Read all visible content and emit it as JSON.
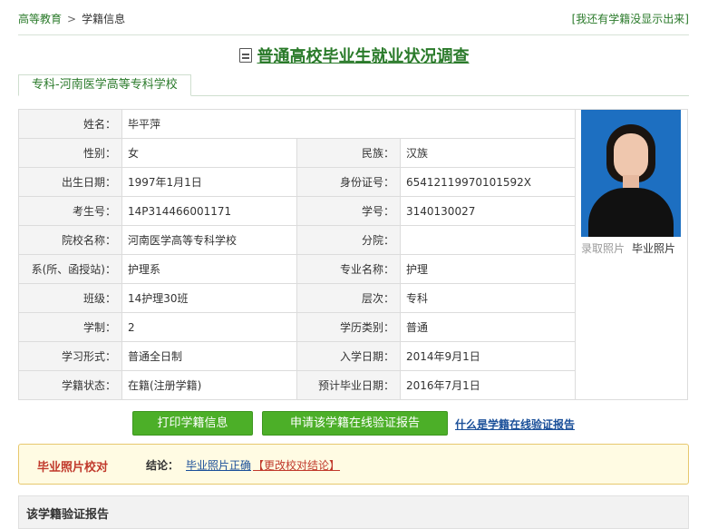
{
  "breadcrumb": {
    "home": "高等教育",
    "sep": ">",
    "current": "学籍信息"
  },
  "not_shown_link": "[我还有学籍没显示出来]",
  "page_title": "普通高校毕业生就业状况调查",
  "tab_label": "专科-河南医学高等专科学校",
  "info": {
    "name_label": "姓名：",
    "name": "毕平萍",
    "gender_label": "性别：",
    "gender": "女",
    "ethnicity_label": "民族：",
    "ethnicity": "汉族",
    "birth_label": "出生日期：",
    "birth": "1997年1月1日",
    "id_label": "身份证号：",
    "id": "65412119970101592X",
    "exam_label": "考生号：",
    "exam": "14P314466001171",
    "student_no_label": "学号：",
    "student_no": "3140130027",
    "school_label": "院校名称：",
    "school": "河南医学高等专科学校",
    "branch_label": "分院：",
    "branch": "",
    "dept_label": "系(所、函授站)：",
    "dept": "护理系",
    "major_label": "专业名称：",
    "major": "护理",
    "class_label": "班级：",
    "class": "14护理30班",
    "level_label": "层次：",
    "level": "专科",
    "duration_label": "学制：",
    "duration": "2",
    "edu_type_label": "学历类别：",
    "edu_type": "普通",
    "form_label": "学习形式：",
    "form": "普通全日制",
    "enroll_label": "入学日期：",
    "enroll": "2014年9月1日",
    "status_label": "学籍状态：",
    "status": "在籍(注册学籍)",
    "grad_label": "预计毕业日期：",
    "grad": "2016年7月1日"
  },
  "photo_links": {
    "admission": "录取照片",
    "graduation": "毕业照片"
  },
  "buttons": {
    "print": "打印学籍信息",
    "apply": "申请该学籍在线验证报告"
  },
  "what_is_link": "什么是学籍在线验证报告",
  "verify": {
    "heading": "毕业照片校对",
    "conclusion_label": "结论：",
    "result": "毕业照片正确",
    "change": "【更改校对结论】"
  },
  "report_heading": "该学籍验证报告",
  "colors": {
    "accent_green": "#2a7a2a",
    "button_green": "#4caf28",
    "alert_red": "#c0392b",
    "link_blue": "#1a4f99"
  }
}
